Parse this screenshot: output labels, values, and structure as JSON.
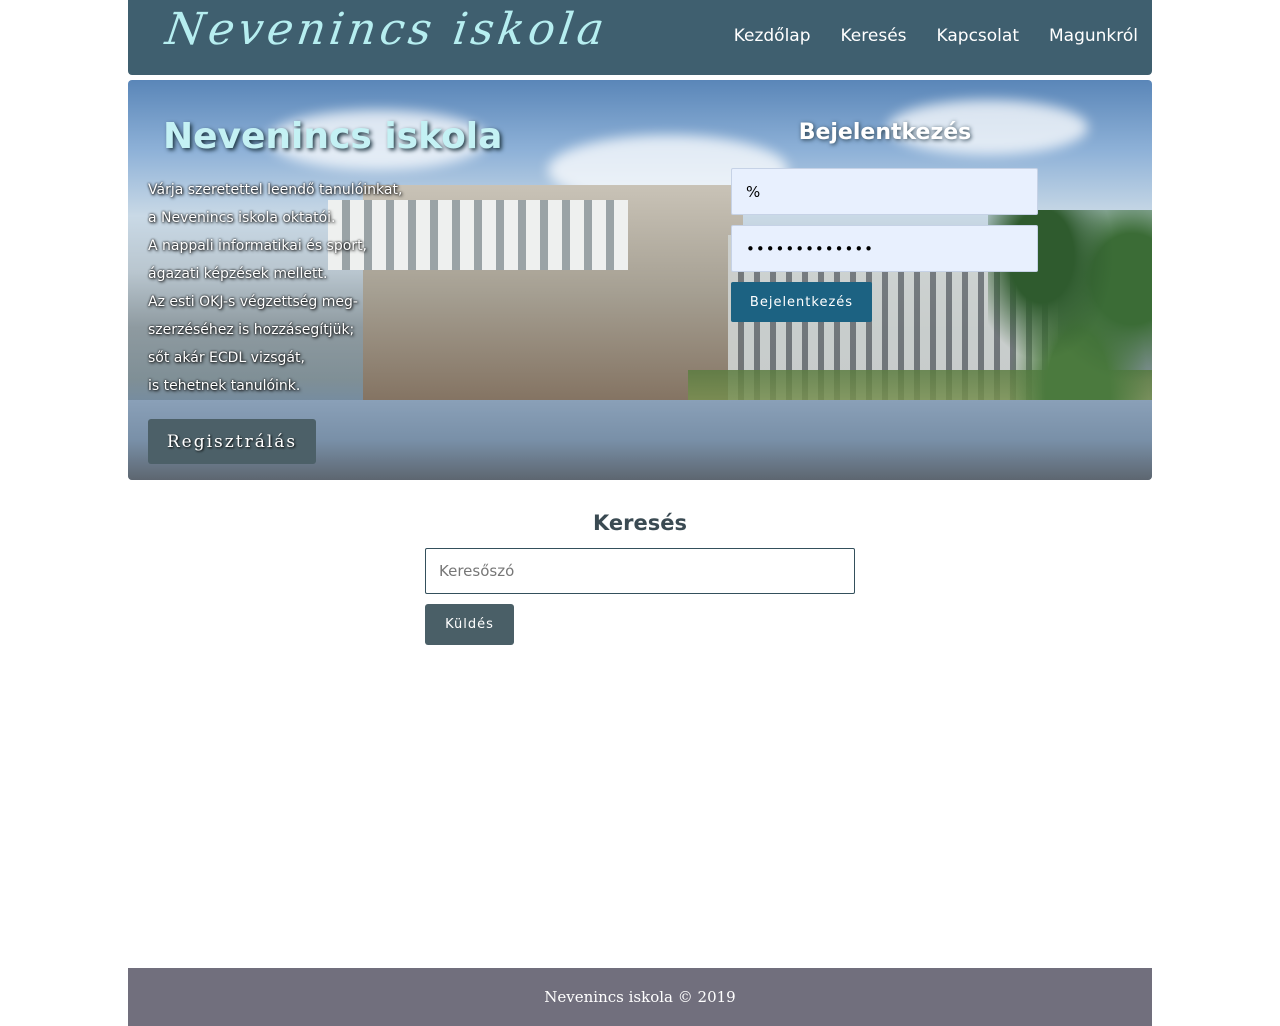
{
  "header": {
    "logo": "Nevenincs iskola",
    "nav": [
      "Kezdőlap",
      "Keresés",
      "Kapcsolat",
      "Magunkról"
    ]
  },
  "hero": {
    "title": "Nevenincs iskola",
    "lines": [
      "Várja szeretettel leendő tanulóinkat,",
      "a Nevenincs iskola oktatói.",
      "A nappali informatikai és sport,",
      "ágazati képzések mellett.",
      "Az esti OKJ-s végzettség meg-",
      "szerzéséhez is hozzásegítjük;",
      "sőt akár ECDL vizsgát,",
      "is tehetnek tanulóink."
    ],
    "register_label": "Regisztrálás"
  },
  "login": {
    "title": "Bejelentkezés",
    "username_value": "%",
    "password_value": "•••••••••••••",
    "button_label": "Bejelentkezés"
  },
  "search": {
    "title": "Keresés",
    "placeholder": "Keresőszó",
    "button_label": "Küldés"
  },
  "footer": {
    "text": "Nevenincs iskola © 2019"
  },
  "colors": {
    "header_bg": "#3f5f6f",
    "logo": "#b6eef0",
    "login_button": "#1c6282",
    "search_button": "#4a5f67",
    "footer_bg": "#716f7d"
  }
}
